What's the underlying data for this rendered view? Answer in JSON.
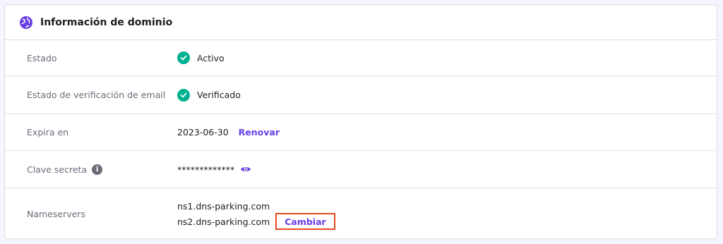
{
  "card": {
    "title": "Información de dominio",
    "icon": "globe-icon",
    "accent": "#673de6"
  },
  "rows": {
    "estado": {
      "label": "Estado",
      "value": "Activo",
      "icon": "check-circle-icon",
      "icon_color": "#00b090"
    },
    "email": {
      "label": "Estado de verificación de email",
      "value": "Verificado",
      "icon": "check-circle-icon",
      "icon_color": "#00b090"
    },
    "expira": {
      "label": "Expira en",
      "value": "2023-06-30",
      "action": "Renovar"
    },
    "clave": {
      "label": "Clave secreta",
      "info_icon": "info-icon",
      "value": "*************",
      "action_icon": "eye-icon"
    },
    "nameservers": {
      "label": "Nameservers",
      "values": [
        "ns1.dns-parking.com",
        "ns2.dns-parking.com"
      ],
      "action": "Cambiar",
      "highlight_color": "#e8491d"
    }
  }
}
